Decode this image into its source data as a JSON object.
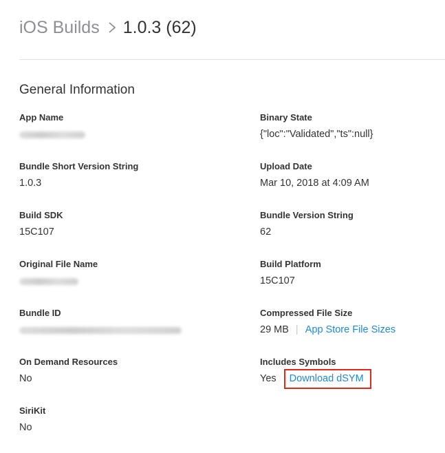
{
  "breadcrumb": {
    "parent": "iOS Builds",
    "current": "1.0.3 (62)"
  },
  "section_title": "General Information",
  "fields": {
    "app_name": {
      "label": "App Name",
      "value_redacted": true
    },
    "binary_state": {
      "label": "Binary State",
      "value": "{\"loc\":\"Validated\",\"ts\":null}"
    },
    "bundle_short_version": {
      "label": "Bundle Short Version String",
      "value": "1.0.3"
    },
    "upload_date": {
      "label": "Upload Date",
      "value": "Mar 10, 2018 at 4:09 AM"
    },
    "build_sdk": {
      "label": "Build SDK",
      "value": "15C107"
    },
    "bundle_version": {
      "label": "Bundle Version String",
      "value": "62"
    },
    "original_file_name": {
      "label": "Original File Name",
      "value_redacted": true
    },
    "build_platform": {
      "label": "Build Platform",
      "value": "15C107"
    },
    "bundle_id": {
      "label": "Bundle ID",
      "value_redacted": true
    },
    "compressed_file_size": {
      "label": "Compressed File Size",
      "value": "29 MB",
      "separator": "|",
      "link": "App Store File Sizes"
    },
    "on_demand_resources": {
      "label": "On Demand Resources",
      "value": "No"
    },
    "includes_symbols": {
      "label": "Includes Symbols",
      "value": "Yes",
      "link": "Download dSYM"
    },
    "sirikit": {
      "label": "SiriKit",
      "value": "No"
    }
  },
  "colors": {
    "link": "#1a8bd9",
    "highlight_border": "#e0281b",
    "muted": "#8e8e93",
    "text": "#333333"
  },
  "icons": {
    "breadcrumb_separator": "chevron-right-icon"
  }
}
